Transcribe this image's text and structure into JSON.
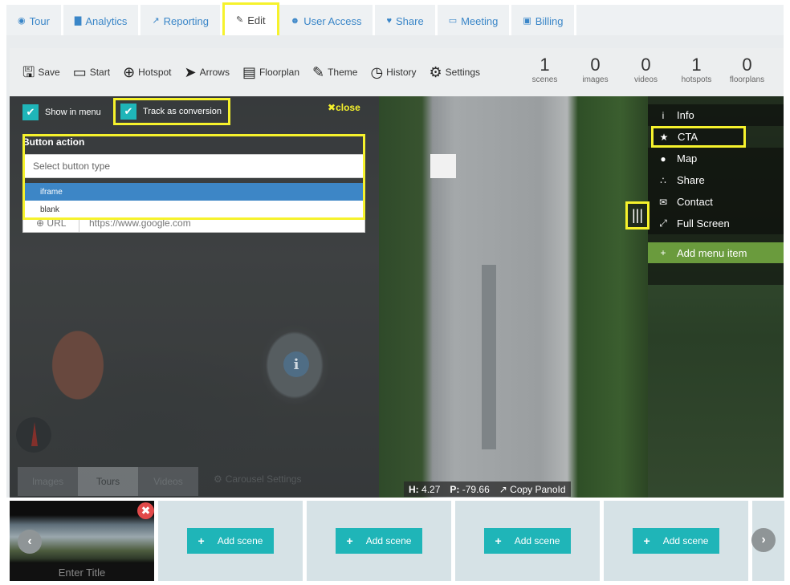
{
  "tabs": [
    {
      "label": "Tour",
      "icon": "map-marker-icon"
    },
    {
      "label": "Analytics",
      "icon": "bar-chart-icon"
    },
    {
      "label": "Reporting",
      "icon": "line-chart-icon"
    },
    {
      "label": "Edit",
      "icon": "pencil-icon",
      "active": true
    },
    {
      "label": "User Access",
      "icon": "users-icon"
    },
    {
      "label": "Share",
      "icon": "heart-icon"
    },
    {
      "label": "Meeting",
      "icon": "monitor-icon"
    },
    {
      "label": "Billing",
      "icon": "lock-icon"
    }
  ],
  "toolbar": {
    "tools": [
      "Save",
      "Start",
      "Hotspot",
      "Arrows",
      "Floorplan",
      "Theme",
      "History",
      "Settings"
    ],
    "stats": [
      {
        "value": "1",
        "label": "scenes"
      },
      {
        "value": "0",
        "label": "images"
      },
      {
        "value": "0",
        "label": "videos"
      },
      {
        "value": "1",
        "label": "hotspots"
      },
      {
        "value": "0",
        "label": "floorplans"
      }
    ]
  },
  "panel": {
    "show_in_menu": "Show in menu",
    "track_conversion": "Track as conversion",
    "close": "close",
    "button_action_label": "Button action",
    "select_placeholder": "Select button type",
    "options": [
      "iframe",
      "blank"
    ],
    "url_label": "URL",
    "url_value": "https://www.google.com"
  },
  "menu": {
    "items": [
      {
        "label": "Info",
        "icon": "info-icon"
      },
      {
        "label": "CTA",
        "icon": "star-icon"
      },
      {
        "label": "Map",
        "icon": "map-pin-icon"
      },
      {
        "label": "Share",
        "icon": "share-icon"
      },
      {
        "label": "Contact",
        "icon": "envelope-icon"
      },
      {
        "label": "Full Screen",
        "icon": "fullscreen-icon"
      }
    ],
    "add_item": "Add menu item"
  },
  "carousel": {
    "tabs": [
      "Images",
      "Tours",
      "Videos"
    ],
    "settings": "Carousel Settings"
  },
  "readout": {
    "h_label": "H:",
    "h_value": "4.27",
    "p_label": "P:",
    "p_value": "-79.66",
    "copy": "Copy PanoId"
  },
  "scenes": {
    "thumb_title": "Enter Title",
    "add_label": "Add scene"
  },
  "colors": {
    "accent_teal": "#1fb5b8",
    "highlight_yellow": "#f6f22c",
    "link_blue": "#3a86c8",
    "add_green": "#6a9b3d",
    "delete_red": "#e24a4a"
  }
}
